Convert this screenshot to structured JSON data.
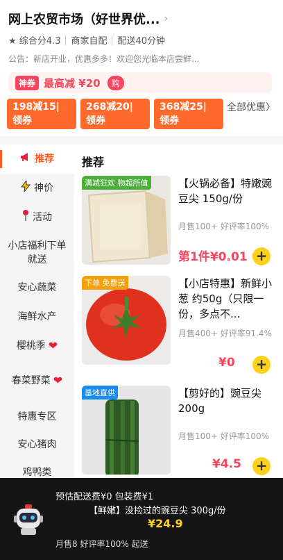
{
  "store": {
    "title": "网上农贸市场（好世界优...",
    "rating": "★ 综合分4.3",
    "delivery_by": "商家自配",
    "delivery_time": "配送40分钟",
    "notice": "公告：新店开业，优惠多多！欢迎您光临本店尝鲜..."
  },
  "promo": {
    "badge": "神券",
    "max_cut": "最高减 ¥20",
    "buy": "购"
  },
  "coupons": [
    {
      "line1": "198减15|",
      "line2": "领券"
    },
    {
      "line1": "268减20|",
      "line2": "领券"
    },
    {
      "line1": "368减25|",
      "line2": "领券"
    }
  ],
  "all_coupons": "全部优惠〉",
  "sidebar": {
    "items": [
      {
        "label": "推荐",
        "icon": "megaphone-icon"
      },
      {
        "label": "神价",
        "icon": "lightning-icon"
      },
      {
        "label": "活动",
        "icon": "pin-icon"
      },
      {
        "label": "小店福利下单就送"
      },
      {
        "label": "安心蔬菜"
      },
      {
        "label": "海鲜水产"
      },
      {
        "label": "樱桃季"
      },
      {
        "label": "春菜野菜"
      },
      {
        "label": "特惠专区"
      },
      {
        "label": "安心猪肉"
      },
      {
        "label": "鸡鸭类"
      }
    ]
  },
  "section_title": "推荐",
  "products": [
    {
      "tag": "满减狂欢 物超所值",
      "tag_color": "#4caf3a",
      "name": "【火锅必备】特嫩豌豆尖 150g/份",
      "sales": "月售100+ 好评率100%",
      "price": "第1件¥0.01",
      "price_suffix": "¥"
    },
    {
      "tag": "下单 免费送",
      "tag_color": "#f2a00c",
      "name": "【小店特惠】新鲜小葱 约50g（只限一份，多点不...",
      "sales": "月售400+ 好评率91.4%",
      "price": "¥0"
    },
    {
      "tag": "基地直供",
      "tag_color": "#1a8cf0",
      "name": "【剪好的】豌豆尖200g",
      "sales": "月售100+ 好评率100%",
      "price": "¥4.5"
    }
  ],
  "bottom": {
    "fee": "预估配送费¥0 包装费¥1",
    "item": "【鲜嫩】没捡过的豌豆尖 300g/份",
    "price": "¥24.9",
    "sales": "月售8 好评率100% 起送"
  }
}
